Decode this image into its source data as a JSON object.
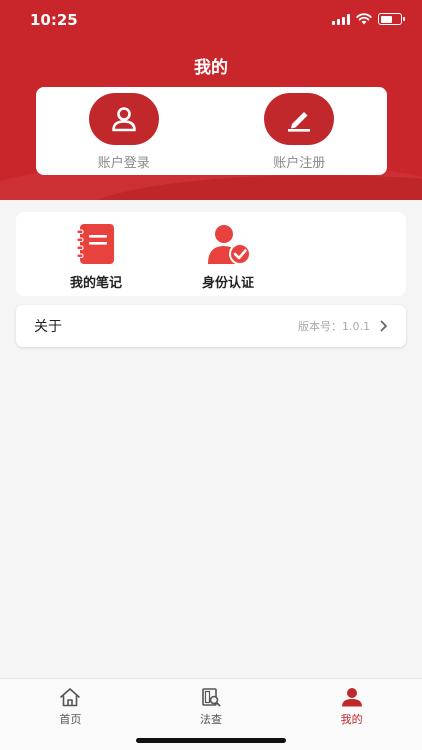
{
  "status": {
    "time": "10:25"
  },
  "page": {
    "title": "我的"
  },
  "account": {
    "login_label": "账户登录",
    "register_label": "账户注册"
  },
  "functions": [
    {
      "label": "我的笔记",
      "icon": "notebook-icon"
    },
    {
      "label": "身份认证",
      "icon": "identity-verify-icon"
    }
  ],
  "about": {
    "label": "关于",
    "version": "版本号：1.0.1"
  },
  "tabs": [
    {
      "label": "首页",
      "icon": "home-icon"
    },
    {
      "label": "法查",
      "icon": "law-search-icon"
    },
    {
      "label": "我的",
      "icon": "user-icon",
      "active": true
    }
  ],
  "colors": {
    "brand": "#c8262a",
    "icon_red": "#e8423f",
    "background": "#f5f5f5"
  }
}
